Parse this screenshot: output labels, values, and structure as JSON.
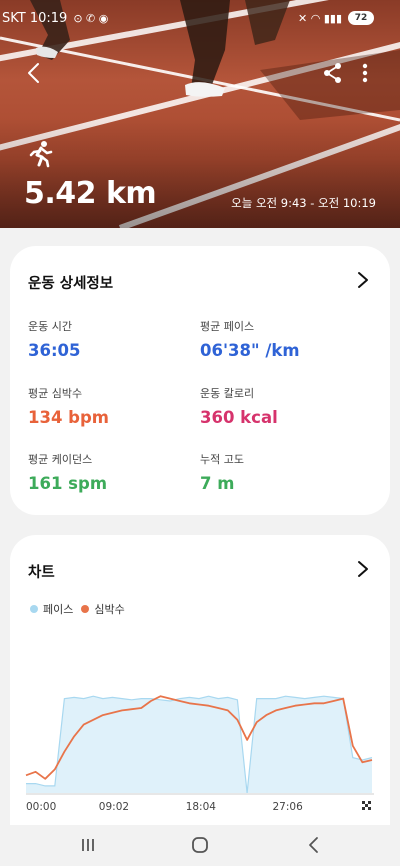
{
  "status_bar": {
    "carrier_time": "SKT 10:19",
    "battery": "72"
  },
  "hero": {
    "distance": "5.42 km",
    "time_range": "오늘 오전 9:43 - 오전 10:19",
    "icons": [
      "back-icon",
      "share-icon",
      "more-vertical-icon",
      "running-icon"
    ]
  },
  "details": {
    "title": "운동 상세정보",
    "stats": [
      {
        "label": "운동 시간",
        "value": "36:05",
        "color": "#2f63d6"
      },
      {
        "label": "평균 페이스",
        "value": "06'38\" /km",
        "color": "#2f63d6"
      },
      {
        "label": "평균 심박수",
        "value": "134 bpm",
        "color": "#e8623a"
      },
      {
        "label": "운동 칼로리",
        "value": "360 kcal",
        "color": "#d6336c"
      },
      {
        "label": "평균 케이던스",
        "value": "161 spm",
        "color": "#3dab5a"
      },
      {
        "label": "누적 고도",
        "value": "7 m",
        "color": "#3dab5a"
      }
    ]
  },
  "chart_card": {
    "title": "차트",
    "legend": [
      {
        "name": "페이스",
        "color": "#a8d8f0"
      },
      {
        "name": "심박수",
        "color": "#e8744a"
      }
    ]
  },
  "chart_data": {
    "type": "area",
    "x_tick_labels": [
      "00:00",
      "09:02",
      "18:04",
      "27:06"
    ],
    "x_minutes": [
      0,
      1,
      2,
      3,
      4,
      5,
      6,
      7,
      8,
      9,
      10,
      11,
      12,
      13,
      14,
      15,
      16,
      17,
      18,
      19,
      20,
      21,
      22,
      23,
      24,
      25,
      26,
      27,
      28,
      29,
      30,
      31,
      32,
      33,
      34,
      35,
      36
    ],
    "series": [
      {
        "name": "페이스",
        "color": "#a8d8f0",
        "values": [
          0.08,
          0.08,
          0.06,
          0.06,
          0.8,
          0.81,
          0.8,
          0.82,
          0.8,
          0.81,
          0.8,
          0.79,
          0.8,
          0.8,
          0.79,
          0.78,
          0.8,
          0.81,
          0.8,
          0.82,
          0.8,
          0.81,
          0.79,
          0.0,
          0.8,
          0.8,
          0.8,
          0.82,
          0.81,
          0.8,
          0.81,
          0.82,
          0.81,
          0.8,
          0.3,
          0.28,
          0.3
        ]
      },
      {
        "name": "심박수",
        "color": "#e8744a",
        "values": [
          0.15,
          0.18,
          0.12,
          0.2,
          0.35,
          0.48,
          0.58,
          0.62,
          0.66,
          0.68,
          0.7,
          0.71,
          0.72,
          0.78,
          0.82,
          0.8,
          0.78,
          0.76,
          0.75,
          0.74,
          0.72,
          0.7,
          0.62,
          0.45,
          0.6,
          0.66,
          0.7,
          0.72,
          0.74,
          0.75,
          0.76,
          0.76,
          0.78,
          0.8,
          0.4,
          0.26,
          0.28
        ]
      }
    ],
    "end_marker": "finish-flag-icon"
  },
  "nav_bar": {
    "buttons": [
      "recent-apps-button",
      "home-button",
      "back-button"
    ]
  }
}
